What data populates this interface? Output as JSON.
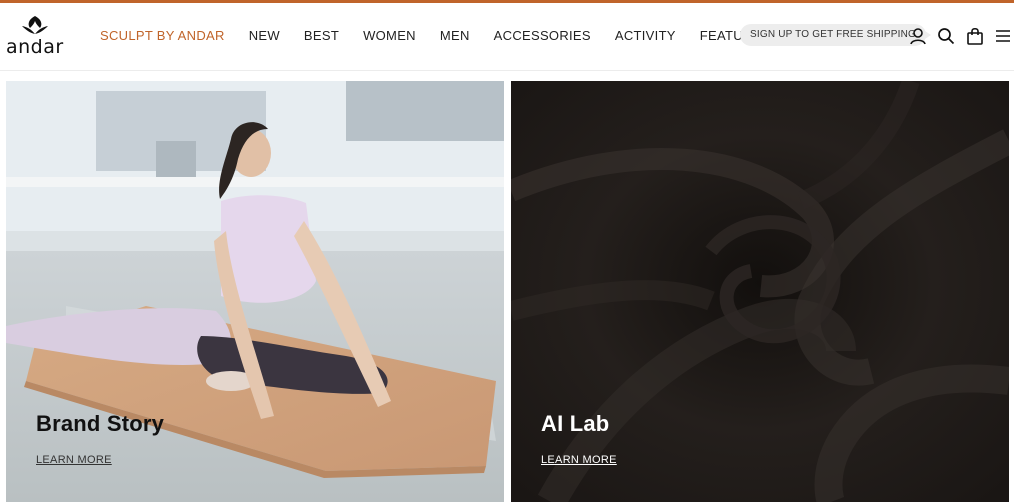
{
  "brand": {
    "name": "andar"
  },
  "nav": {
    "items": [
      {
        "label": "SCULPT BY ANDAR",
        "accent": true
      },
      {
        "label": "NEW"
      },
      {
        "label": "BEST"
      },
      {
        "label": "WOMEN"
      },
      {
        "label": "MEN"
      },
      {
        "label": "ACCESSORIES"
      },
      {
        "label": "ACTIVITY"
      },
      {
        "label": "FEATURED"
      }
    ]
  },
  "promo": {
    "label": "SIGN UP TO GET FREE SHIPPING"
  },
  "header_icons": [
    "account-icon",
    "search-icon",
    "shopping-bag-icon",
    "menu-icon"
  ],
  "panels": [
    {
      "title": "Brand Story",
      "link": "LEARN MORE",
      "image": "woman doing yoga stretch on cork mat in bright studio"
    },
    {
      "title": "AI Lab",
      "link": "LEARN MORE",
      "image": "swirled dark brown fabric close-up"
    }
  ],
  "colors": {
    "accent": "#c0642a",
    "pill_bg": "#ededed",
    "fabric_dark": "#1c1816"
  }
}
